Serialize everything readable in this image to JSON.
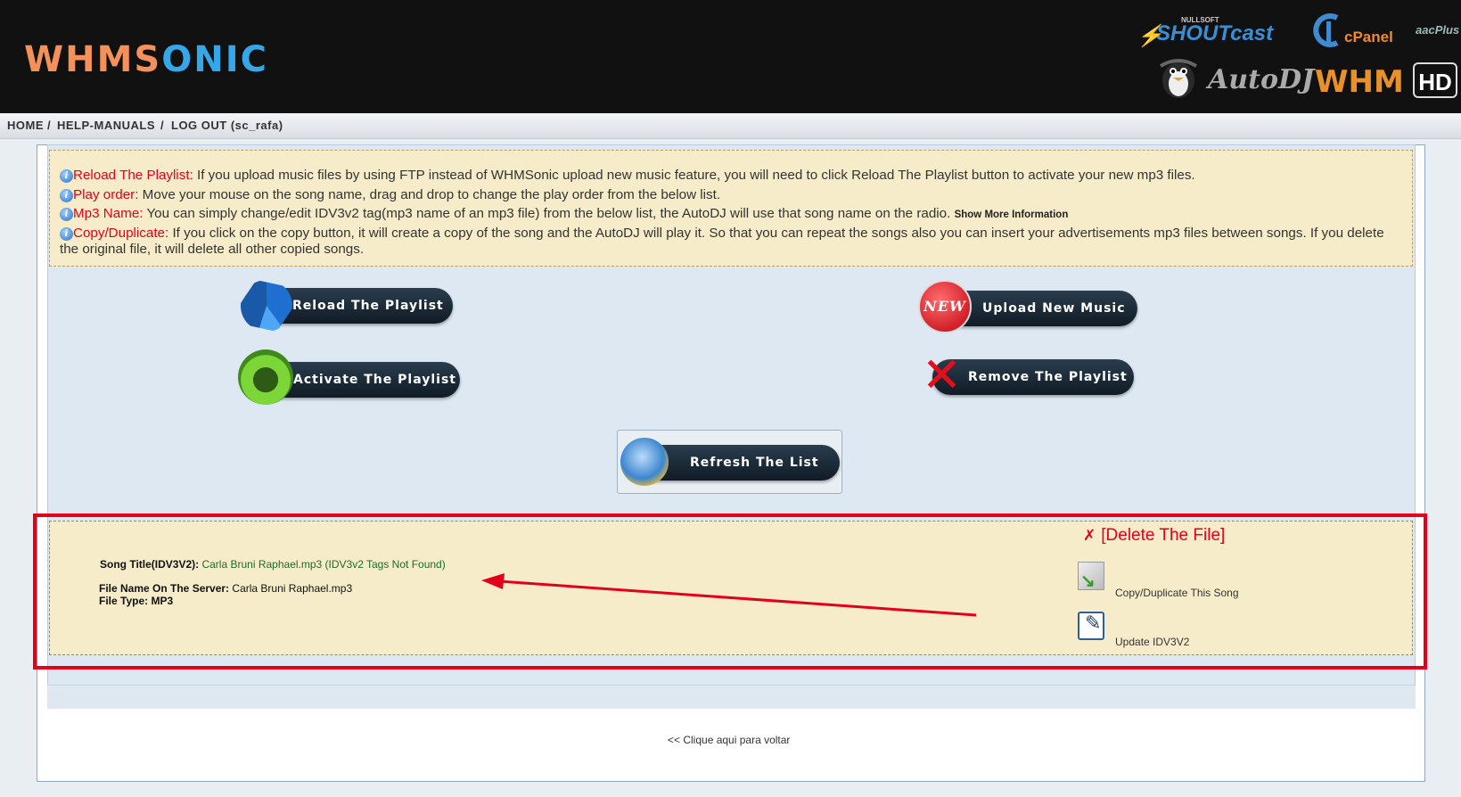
{
  "header": {
    "logo_part1": "WHMS",
    "logo_part2": "ONIC",
    "brands": {
      "nullsoft": "NULLSOFT",
      "shoutcast": "SHOUTcast",
      "cpanel": "cPanel",
      "aacplus": "aacPlus",
      "autodj": "AutoDJ",
      "whm": "WHM",
      "hd": "HD"
    }
  },
  "nav": {
    "home": "HOME",
    "sep1": "/",
    "help": "HELP-MANUALS",
    "sep2": "/",
    "logout": "LOG OUT (sc_rafa)"
  },
  "info": {
    "reload_key": "Reload The Playlist:",
    "reload_text": " If you upload music files by using FTP instead of WHMSonic upload new music feature, you will need to click Reload The Playlist button to activate your new mp3 files.",
    "order_key": "Play order:",
    "order_text": " Move your mouse on the song name, drag and drop to change the play order from the below list.",
    "mp3_key": "Mp3 Name:",
    "mp3_text": " You can simply change/edit IDV3v2 tag(mp3 name of an mp3 file) from the below list, the AutoDJ will use that song name on the radio.",
    "more": "Show More Information",
    "copy_key": "Copy/Duplicate:",
    "copy_text": " If you click on the copy button, it will create a copy of the song and the AutoDJ will play it. So that you can repeat the songs also you can insert your advertisements mp3 files between songs. If you delete the original file, it will delete all other copied songs."
  },
  "buttons": {
    "reload": "Reload The Playlist",
    "activate": "Activate The Playlist",
    "upload": "Upload New Music",
    "upload_badge": "NEW",
    "remove": "Remove The Playlist",
    "refresh": "Refresh The List"
  },
  "song": {
    "title_label": "Song Title(IDV3V2):",
    "title_value": "Carla Bruni Raphael.mp3 (IDV3v2 Tags Not Found)",
    "filename_label": "File Name On The Server:",
    "filename_value": "Carla Bruni Raphael.mp3",
    "filetype_label": "File Type:",
    "filetype_value": "MP3",
    "delete": "[Delete The File]",
    "copy": "Copy/Duplicate This Song",
    "update": "Update IDV3V2"
  },
  "footer": {
    "back": "<< Clique aqui para voltar"
  },
  "colors": {
    "accent_red": "#e2001a",
    "info_bg": "#f6ecc9",
    "panel_bg": "#dee8f2",
    "header_bg": "#111111"
  }
}
